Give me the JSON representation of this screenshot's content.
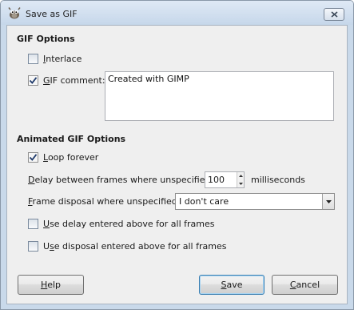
{
  "window": {
    "title": "Save as GIF",
    "icon": "gimp-wilber-icon",
    "close_icon": "close-icon"
  },
  "gif_options": {
    "heading": "GIF Options",
    "interlace": {
      "label": "Interlace",
      "checked": false
    },
    "gif_comment": {
      "label": "GIF comment:",
      "checked": true,
      "value": "Created with GIMP"
    }
  },
  "animated_options": {
    "heading": "Animated GIF Options",
    "loop_forever": {
      "label": "Loop forever",
      "checked": true
    },
    "delay": {
      "label": "Delay between frames where unspecified:",
      "value": "100",
      "unit": "milliseconds"
    },
    "disposal": {
      "label": "Frame disposal where unspecified:",
      "selected": "I don't care"
    },
    "use_delay_all": {
      "label": "Use delay entered above for all frames",
      "checked": false
    },
    "use_disposal_all": {
      "label": "Use disposal entered above for all frames",
      "checked": false
    }
  },
  "buttons": {
    "help": "Help",
    "save": "Save",
    "cancel": "Cancel"
  },
  "colors": {
    "accent": "#3c7fb1",
    "checkmark": "#1f3a6b"
  }
}
